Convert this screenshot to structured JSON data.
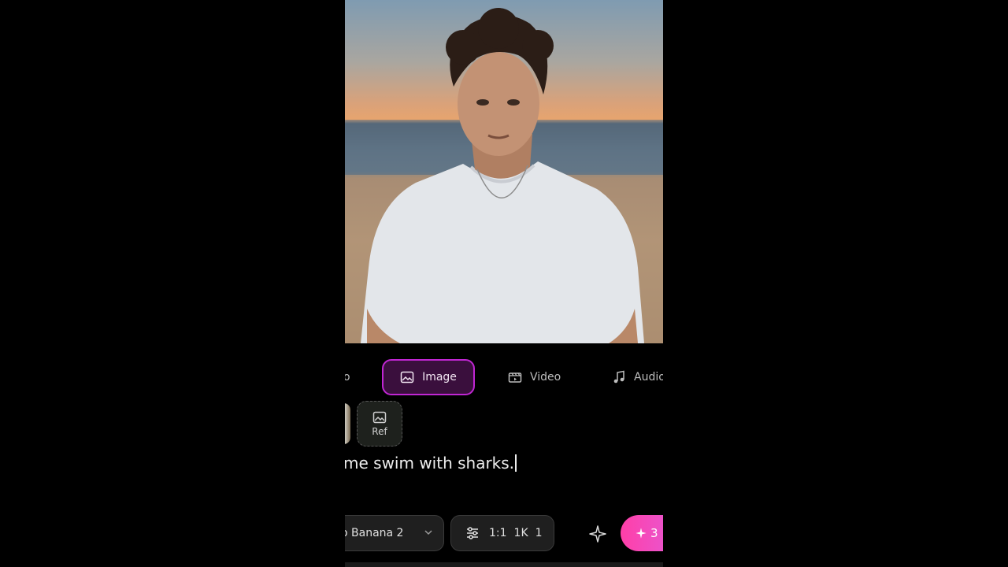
{
  "photo": {
    "alt": "Young man in white t-shirt sitting on a beach at sunset"
  },
  "mode_tabs": {
    "cut_label": "o",
    "image_label": "Image",
    "video_label": "Video",
    "audio_label": "Audio",
    "active": "Image"
  },
  "references": {
    "ref_label": "Ref"
  },
  "prompt": {
    "text": "me swim with sharks."
  },
  "toolbar": {
    "model_label": "o Banana 2",
    "aspect": "1:1",
    "resolution": "1K",
    "count": "1",
    "generate_cost": "3"
  },
  "colors": {
    "accent": "#c026d3",
    "generate_start": "#ff3fa8",
    "generate_end": "#e45bd8"
  },
  "icons": [
    "image-icon",
    "video-icon",
    "music-icon",
    "sliders-icon",
    "sparkle-icon",
    "chevron-down-icon"
  ]
}
